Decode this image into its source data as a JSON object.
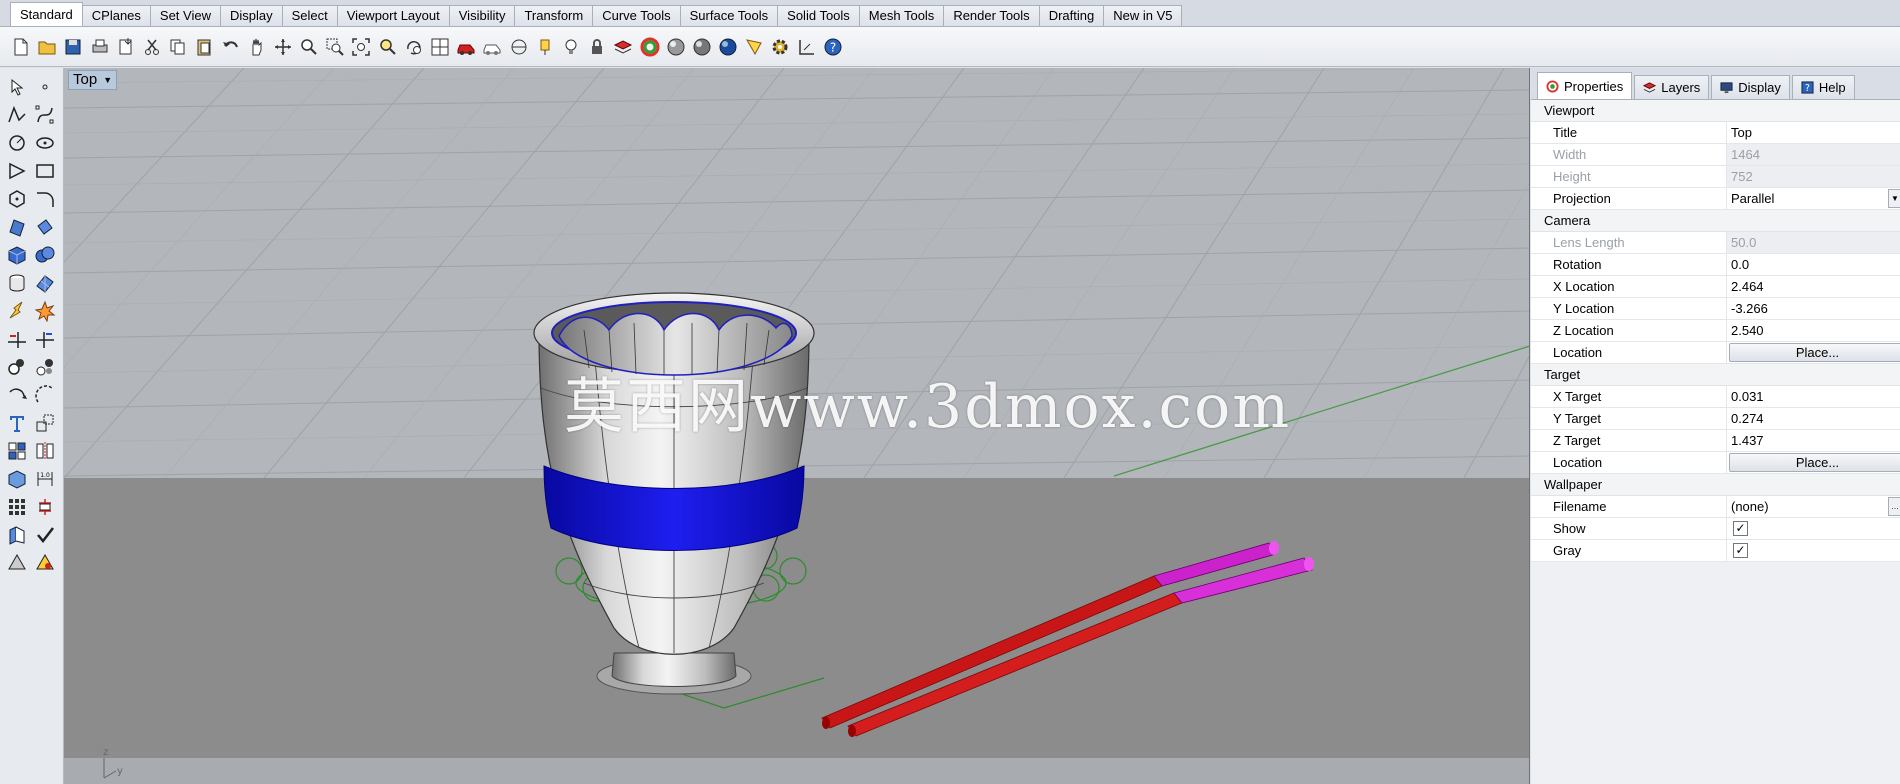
{
  "toolbar_tabs": [
    "Standard",
    "CPlanes",
    "Set View",
    "Display",
    "Select",
    "Viewport Layout",
    "Visibility",
    "Transform",
    "Curve Tools",
    "Surface Tools",
    "Solid Tools",
    "Mesh Tools",
    "Render Tools",
    "Drafting",
    "New in V5"
  ],
  "active_tab": "Standard",
  "toolbar_icons": [
    "new-file-icon",
    "open-folder-icon",
    "save-icon",
    "print-icon",
    "import-icon",
    "cut-icon",
    "copy-icon",
    "paste-icon",
    "undo-icon",
    "pan-hand-icon",
    "rotate-view-icon",
    "zoom-dynamic-icon",
    "zoom-window-icon",
    "zoom-extents-icon",
    "zoom-selected-icon",
    "rotate-camera-icon",
    "four-viewports-icon",
    "car-icon",
    "car-outline-icon",
    "grid-snap-icon",
    "light-bulb-icon",
    "light-icon",
    "lock-icon",
    "layer-icon",
    "color-wheel-icon",
    "render-sphere-icon",
    "render-sphere-2-icon",
    "render-sphere-3-icon",
    "spotlight-icon",
    "gear-icon",
    "dimension-icon",
    "help-icon"
  ],
  "viewport": {
    "title": "Top",
    "watermark": "莫西网www.3dmox.com",
    "axis_labels": {
      "z": "z",
      "y": "y"
    }
  },
  "panel_tabs": [
    {
      "label": "Properties",
      "icon": "properties-icon",
      "active": true
    },
    {
      "label": "Layers",
      "icon": "layers-icon",
      "active": false
    },
    {
      "label": "Display",
      "icon": "display-icon",
      "active": false
    },
    {
      "label": "Help",
      "icon": "help-icon",
      "active": false
    }
  ],
  "properties": {
    "viewport_section": "Viewport",
    "title_label": "Title",
    "title_value": "Top",
    "width_label": "Width",
    "width_value": "1464",
    "height_label": "Height",
    "height_value": "752",
    "projection_label": "Projection",
    "projection_value": "Parallel",
    "camera_section": "Camera",
    "lens_label": "Lens Length",
    "lens_value": "50.0",
    "rotation_label": "Rotation",
    "rotation_value": "0.0",
    "xloc_label": "X Location",
    "xloc_value": "2.464",
    "yloc_label": "Y Location",
    "yloc_value": "-3.266",
    "zloc_label": "Z Location",
    "zloc_value": "2.540",
    "location_label": "Location",
    "place_button": "Place...",
    "target_section": "Target",
    "xtar_label": "X Target",
    "xtar_value": "0.031",
    "ytar_label": "Y Target",
    "ytar_value": "0.274",
    "ztar_label": "Z Target",
    "ztar_value": "1.437",
    "tlocation_label": "Location",
    "tplace_button": "Place...",
    "wallpaper_section": "Wallpaper",
    "filename_label": "Filename",
    "filename_value": "(none)",
    "show_label": "Show",
    "show_checked": "✓",
    "gray_label": "Gray",
    "gray_checked": "✓"
  },
  "colors": {
    "band": "#1010dd",
    "chopstick": "#cc1010",
    "chopstick_tip": "#cc22cc",
    "viewport_bg": "#8c8c8c"
  }
}
